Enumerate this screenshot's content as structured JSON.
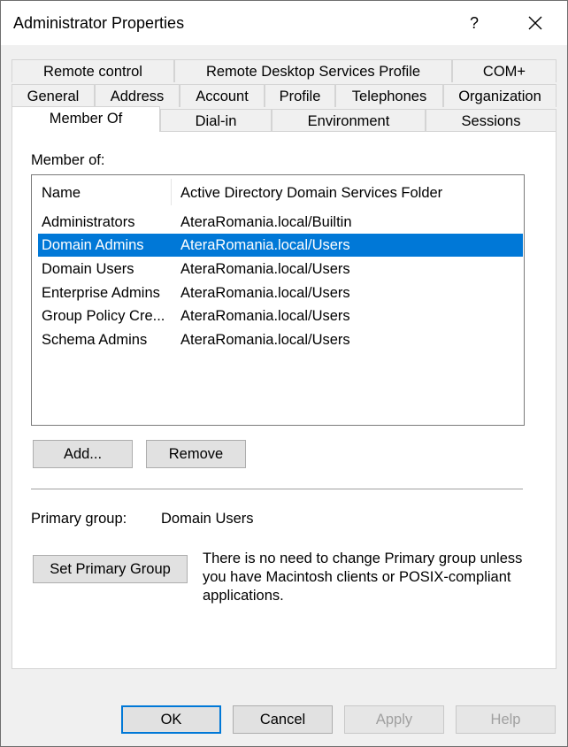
{
  "window": {
    "title": "Administrator Properties",
    "help_label": "?",
    "close_icon": "close-icon"
  },
  "tabs": {
    "row1": [
      "Remote control",
      "Remote Desktop Services Profile",
      "COM+"
    ],
    "row2": [
      "General",
      "Address",
      "Account",
      "Profile",
      "Telephones",
      "Organization"
    ],
    "row3": [
      "Member Of",
      "Dial-in",
      "Environment",
      "Sessions"
    ],
    "active": "Member Of"
  },
  "member_of": {
    "label": "Member of:",
    "columns": [
      "Name",
      "Active Directory Domain Services Folder"
    ],
    "rows": [
      [
        "Administrators",
        "AteraRomania.local/Builtin"
      ],
      [
        "Domain Admins",
        "AteraRomania.local/Users"
      ],
      [
        "Domain Users",
        "AteraRomania.local/Users"
      ],
      [
        "Enterprise Admins",
        "AteraRomania.local/Users"
      ],
      [
        "Group Policy Cre...",
        "AteraRomania.local/Users"
      ],
      [
        "Schema Admins",
        "AteraRomania.local/Users"
      ]
    ],
    "selected_row": "Domain Admins",
    "add_label": "Add...",
    "remove_label": "Remove"
  },
  "primary": {
    "label": "Primary group:",
    "value": "Domain Users",
    "button_label": "Set Primary Group",
    "info": "There is no need to change Primary group unless you have Macintosh clients or POSIX-compliant applications."
  },
  "footer": {
    "ok": "OK",
    "cancel": "Cancel",
    "apply": "Apply",
    "help": "Help"
  },
  "colors": {
    "selection": "#0078d7",
    "dialog_bg": "#f0f0f0"
  }
}
